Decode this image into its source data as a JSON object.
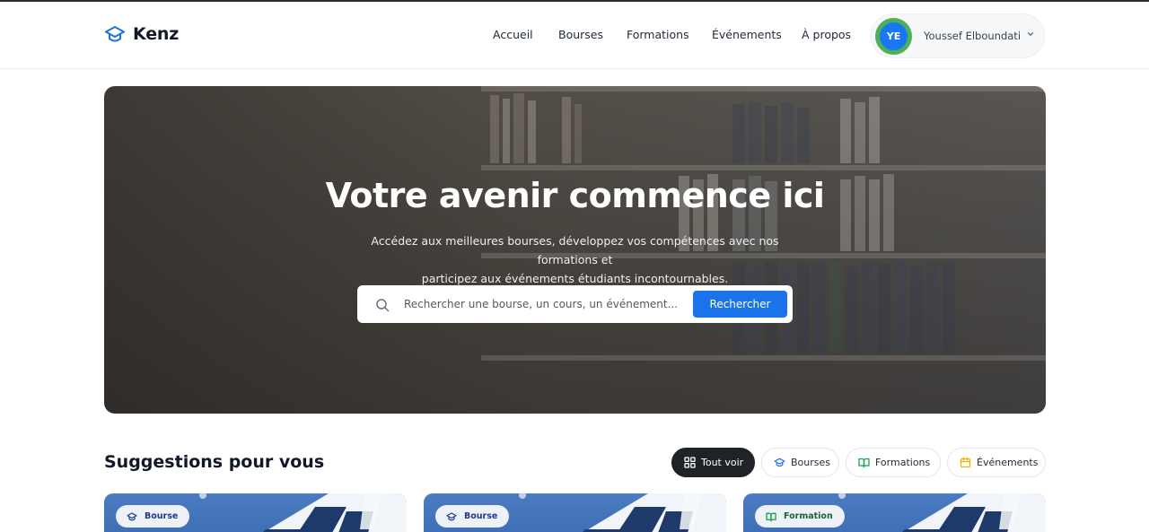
{
  "header": {
    "brand": "Kenz",
    "nav": [
      "Accueil",
      "Bourses",
      "Formations",
      "Événements",
      "À propos"
    ],
    "user": {
      "initials": "YE",
      "name": "Youssef Elboundati"
    }
  },
  "hero": {
    "title": "Votre avenir commence ici",
    "subtitle_line1": "Accédez aux meilleures bourses, développez vos compétences avec nos formations et",
    "subtitle_line2": "participez aux événements étudiants incontournables.",
    "search_placeholder": "Rechercher une bourse, un cours, un événement...",
    "search_button": "Rechercher"
  },
  "suggestions": {
    "title": "Suggestions pour vous",
    "filters": [
      "Tout voir",
      "Bourses",
      "Formations",
      "Événements"
    ],
    "active_filter": "Tout voir",
    "cards": [
      {
        "tag": "Bourse"
      },
      {
        "tag": "Bourse"
      },
      {
        "tag": "Formation"
      }
    ]
  },
  "colors": {
    "accent": "#1a73e8",
    "avatar_ring": "#4cb05a",
    "dark_chip": "#1f2328"
  }
}
